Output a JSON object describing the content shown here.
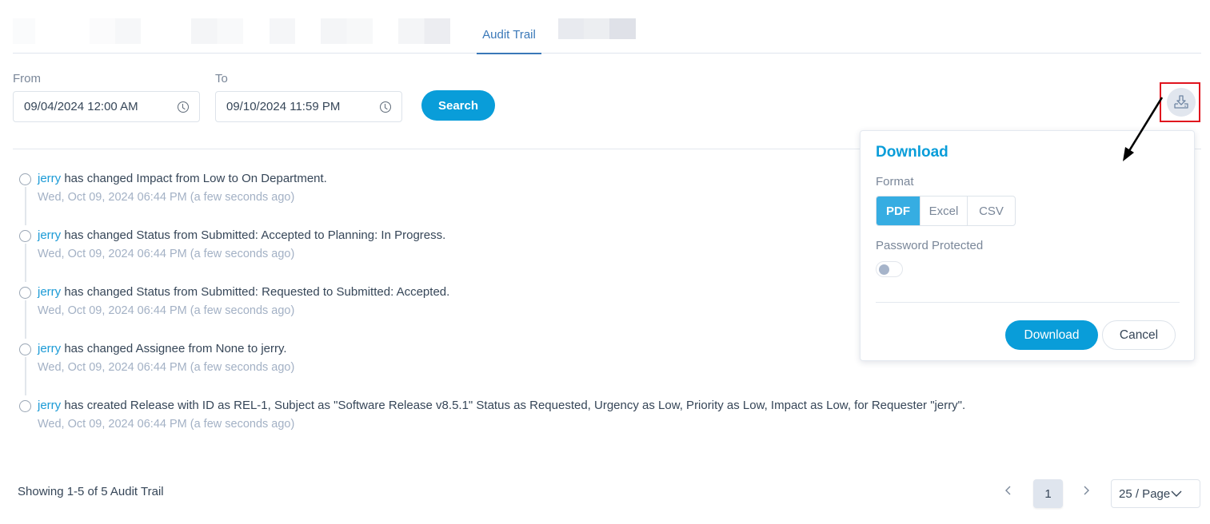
{
  "tabs": {
    "active_label": "Audit Trail"
  },
  "filters": {
    "from_label": "From",
    "from_value": "09/04/2024 12:00 AM",
    "to_label": "To",
    "to_value": "09/10/2024 11:59 PM",
    "search_label": "Search",
    "clock_icon": "clock-icon"
  },
  "toolbar": {
    "download_icon": "download-icon"
  },
  "audit_trail": [
    {
      "user": "jerry",
      "message": " has changed Impact from Low to On Department.",
      "time": "Wed, Oct 09, 2024 06:44 PM (a few seconds ago)"
    },
    {
      "user": "jerry",
      "message": " has changed Status from Submitted: Accepted to Planning: In Progress.",
      "time": "Wed, Oct 09, 2024 06:44 PM (a few seconds ago)"
    },
    {
      "user": "jerry",
      "message": " has changed Status from Submitted: Requested to Submitted: Accepted.",
      "time": "Wed, Oct 09, 2024 06:44 PM (a few seconds ago)"
    },
    {
      "user": "jerry",
      "message": " has changed Assignee from None to jerry.",
      "time": "Wed, Oct 09, 2024 06:44 PM (a few seconds ago)"
    },
    {
      "user": "jerry",
      "message": " has created Release with ID as REL-1, Subject as \"Software Release v8.5.1\" Status as Requested, Urgency as Low, Priority as Low, Impact as Low, for Requester \"jerry\".",
      "time": "Wed, Oct 09, 2024 06:44 PM (a few seconds ago)"
    }
  ],
  "pagination": {
    "showing_text": "Showing 1-5 of 5 Audit Trail",
    "prev": "<",
    "current_page": "1",
    "next": ">",
    "page_size": "25 / Page",
    "page_size_chevron": "∨"
  },
  "download_popover": {
    "title": "Download",
    "format_label": "Format",
    "formats": [
      "PDF",
      "Excel",
      "CSV"
    ],
    "selected_format": "PDF",
    "password_label": "Password Protected",
    "password_protected": false,
    "download_label": "Download",
    "cancel_label": "Cancel"
  },
  "colors": {
    "accent": "#099dd9",
    "tab_active": "#3a78b8",
    "highlight_box": "#e0141e",
    "user_link": "#1a9ad6"
  }
}
